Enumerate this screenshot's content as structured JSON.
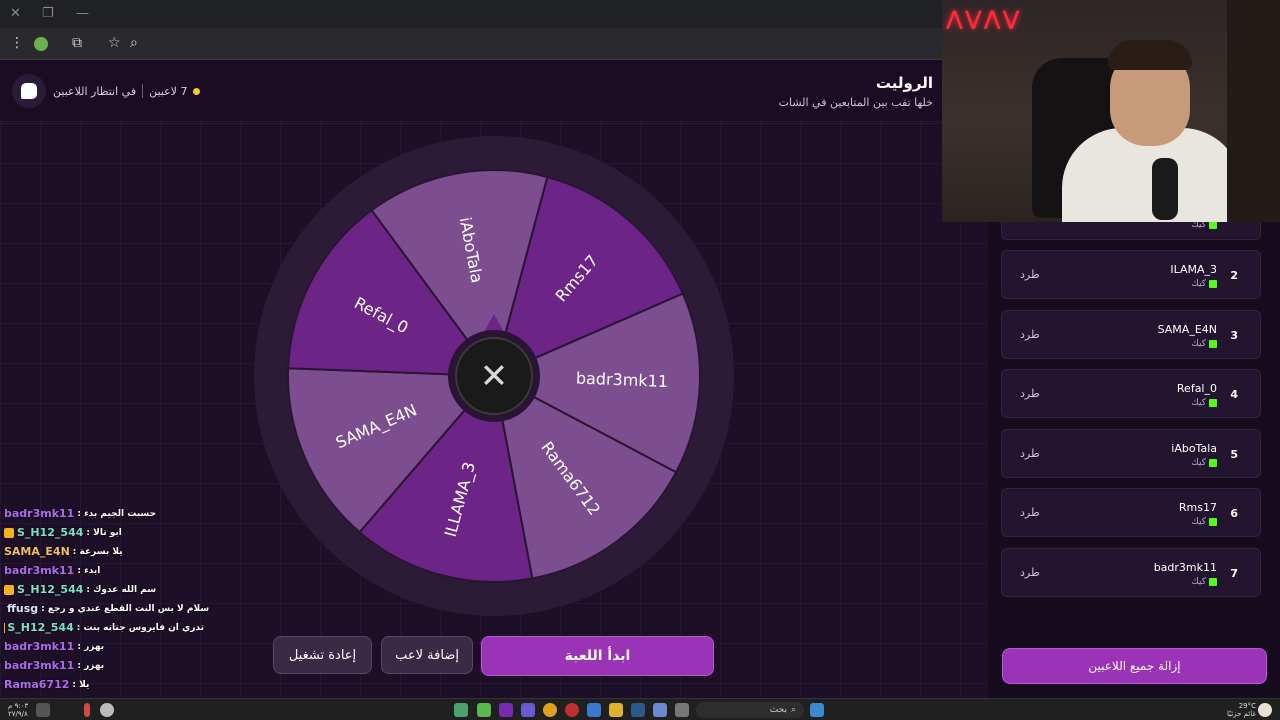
{
  "app": {
    "title": "الروليت",
    "subtitle": "خلها تقب بين المتابعين في الشات",
    "status_players": "7 لاعبين",
    "status_waiting": "في انتظار اللاعبين"
  },
  "wheel": {
    "segments": [
      "Rms17",
      "badr3mk11",
      "Rama6712",
      "ILLAMA_3",
      "SAMA_E4N",
      "Refal_0",
      "iAboTala"
    ],
    "colors": [
      "#6c2587",
      "#7d4e8f",
      "#7d4e8f",
      "#6c2587",
      "#7d4e8f",
      "#6c2587",
      "#7d4e8f"
    ],
    "center_icon": "x-logo-icon"
  },
  "buttons": {
    "start": "ابدأ اللعبة",
    "add_player": "إضافة لاعب",
    "restart": "إعادة تشغيل",
    "remove_all": "إزالة جميع اللاعبين"
  },
  "players": [
    {
      "num": "2",
      "name": "ILAMA_3",
      "source": "كيك",
      "kick": "طرد"
    },
    {
      "num": "3",
      "name": "SAMA_E4N",
      "source": "كيك",
      "kick": "طرد"
    },
    {
      "num": "4",
      "name": "Refal_0",
      "source": "كيك",
      "kick": "طرد"
    },
    {
      "num": "5",
      "name": "iAboTala",
      "source": "كيك",
      "kick": "طرد"
    },
    {
      "num": "6",
      "name": "Rms17",
      "source": "كيك",
      "kick": "طرد"
    },
    {
      "num": "7",
      "name": "badr3mk11",
      "source": "كيك",
      "kick": "طرد"
    }
  ],
  "partial_row_source": "كيك",
  "chat": [
    {
      "user": "badr3mk11",
      "color": "#b06af0",
      "msg": ": حسبت الجيم بدء",
      "badge": ""
    },
    {
      "user": "S_H12_544",
      "color": "#7ce0c3",
      "msg": ": ابو تالا",
      "badge": "crown"
    },
    {
      "user": "SAMA_E4N",
      "color": "#f0c060",
      "msg": ": يلا بسرعة",
      "badge": ""
    },
    {
      "user": "badr3mk11",
      "color": "#b06af0",
      "msg": ": ابدء",
      "badge": ""
    },
    {
      "user": "S_H12_544",
      "color": "#7ce0c3",
      "msg": ": سم الله عدوك",
      "badge": "crown"
    },
    {
      "user": "ffusg",
      "color": "#e0e0ff",
      "msg": ": سلام لا بس النت القطع عندي و رجع",
      "badge": "img"
    },
    {
      "user": "S_H12_544",
      "color": "#7ce0c3",
      "msg": ": تدري ان فايروس جتاته بنت",
      "badge": "crown"
    },
    {
      "user": "badr3mk11",
      "color": "#b06af0",
      "msg": ": بهزر",
      "badge": ""
    },
    {
      "user": "badr3mk11",
      "color": "#b06af0",
      "msg": ": بهزر",
      "badge": ""
    },
    {
      "user": "Rama6712",
      "color": "#b06af0",
      "msg": ": يلا",
      "badge": ""
    }
  ],
  "taskbar": {
    "search": "بحث",
    "temp": "29°C",
    "weather": "غائم جزئيًا",
    "time": "٩:٠٣ م",
    "date": "٢٧/٩/٨"
  }
}
